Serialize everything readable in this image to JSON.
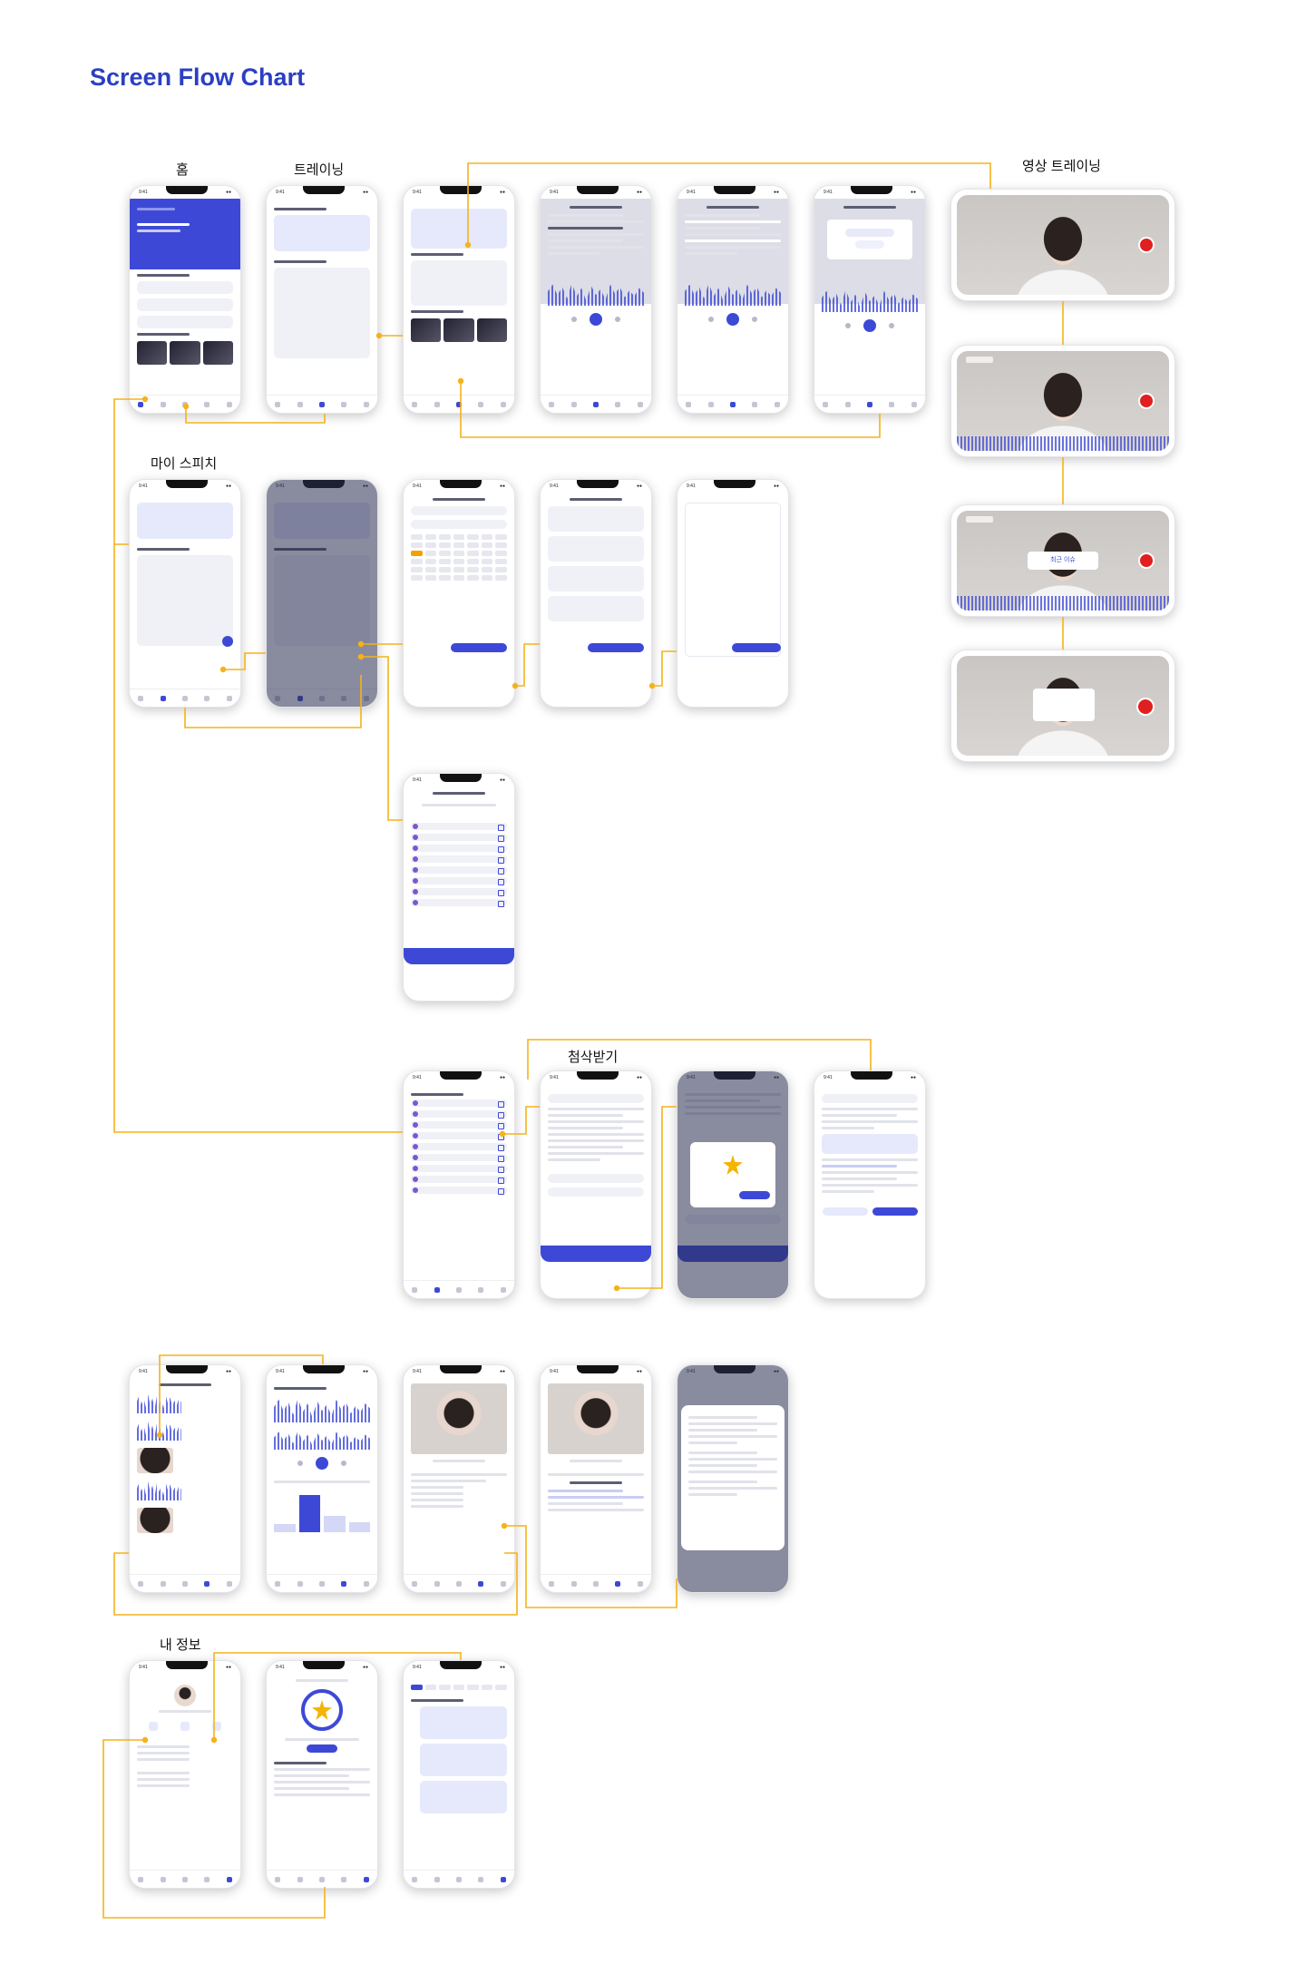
{
  "title": "Screen Flow Chart",
  "sections": {
    "home": "홈",
    "training": "트레이닝",
    "video_training": "영상 트레이닝",
    "my_speech": "마이 스피치",
    "correction": "첨삭받기",
    "my_info": "내 정보"
  },
  "video_popup": "최근 이슈",
  "colors": {
    "accent": "#3d49d6",
    "flow_line": "#f5b21b",
    "title": "#2b3fc4",
    "record": "#e02020"
  }
}
